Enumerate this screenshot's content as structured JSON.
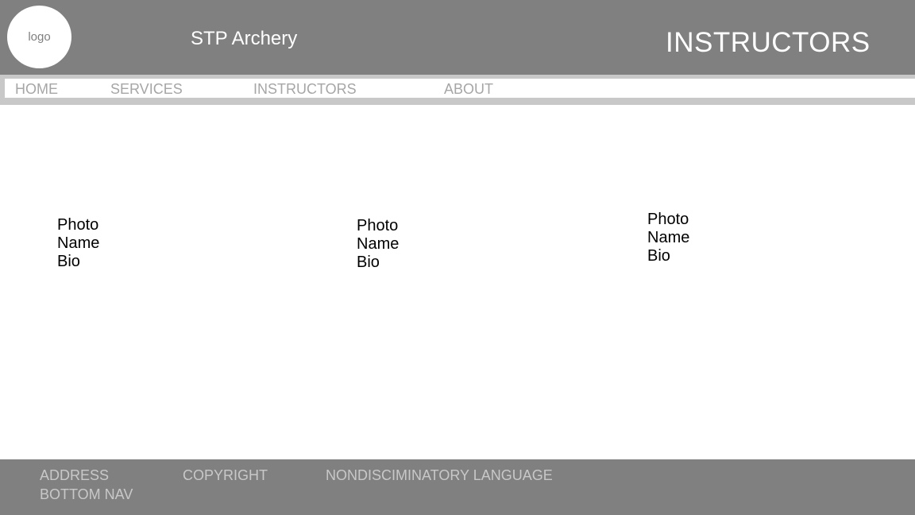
{
  "header": {
    "logo_label": "logo",
    "site_title": "STP Archery",
    "page_title": "INSTRUCTORS"
  },
  "nav": {
    "items": [
      {
        "label": "HOME"
      },
      {
        "label": "SERVICES"
      },
      {
        "label": "INSTRUCTORS"
      },
      {
        "label": "ABOUT"
      }
    ]
  },
  "instructors": [
    {
      "photo": "Photo",
      "name": "Name",
      "bio": "Bio"
    },
    {
      "photo": "Photo",
      "name": "Name",
      "bio": "Bio"
    },
    {
      "photo": "Photo",
      "name": "Name",
      "bio": "Bio"
    }
  ],
  "footer": {
    "address": "ADDRESS",
    "copyright": "COPYRIGHT",
    "nondiscriminatory": "NONDISCIMINATORY LANGUAGE",
    "bottom_nav": "BOTTOM NAV"
  },
  "colors": {
    "header_bg": "#808080",
    "nav_border": "#c8c8c8",
    "nav_text": "#a6a6a6",
    "footer_text": "#c8c8c8"
  }
}
